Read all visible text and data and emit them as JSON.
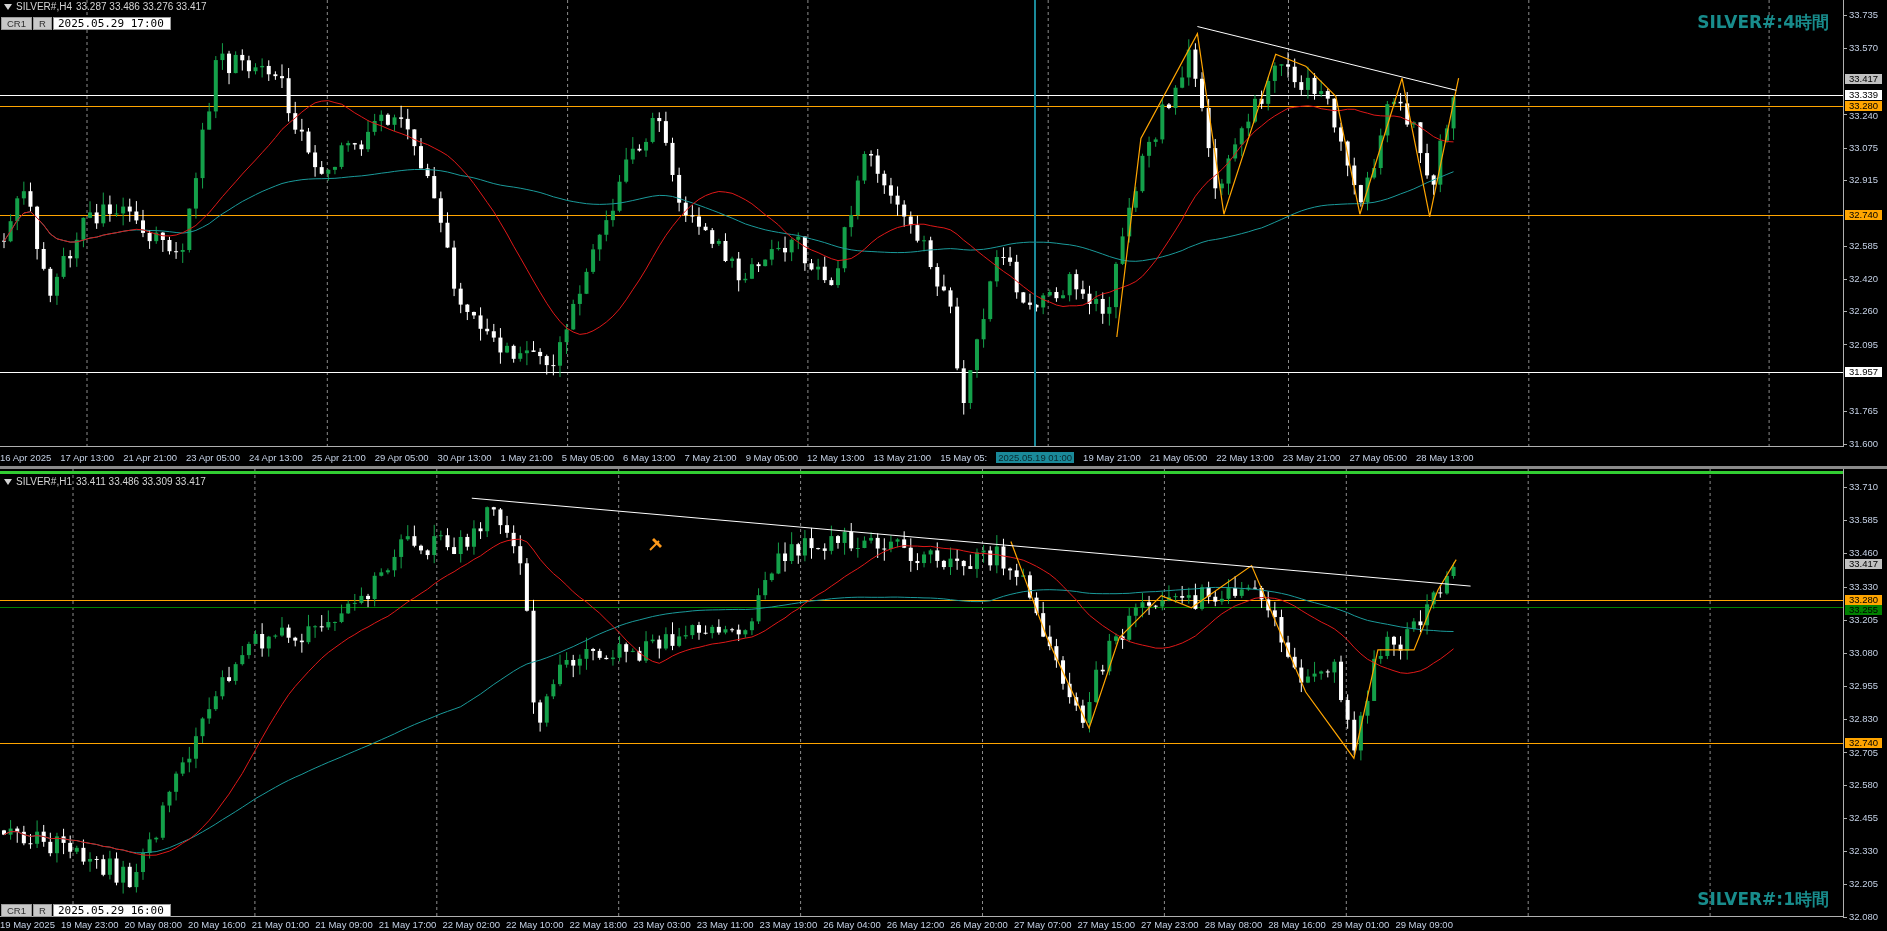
{
  "panels": [
    {
      "symbol": "SILVER#,H4",
      "ohlc": "33.287 33.486 33.276 33.417",
      "active": false,
      "buttons": [
        "CR1",
        "R"
      ],
      "crosshair_time": "2025.05.29 17:00",
      "title": "SILVER#:4時間",
      "price_ticks": [
        "33.735",
        "33.570",
        "33.240",
        "33.075",
        "32.915",
        "32.585",
        "32.420",
        "32.260",
        "32.095",
        "31.765",
        "31.600"
      ],
      "price_labels": [
        {
          "text": "33.417",
          "color": "#c0c0c0"
        },
        {
          "text": "33.339",
          "color": "#ffffff",
          "level_line": true
        },
        {
          "text": "33.280",
          "color": "#ffa500",
          "level_line": true
        },
        {
          "text": "32.740",
          "color": "#ffa500",
          "level_line": true
        },
        {
          "text": "31.957",
          "color": "#ffffff",
          "level_line": true
        }
      ],
      "time_labels": [
        {
          "text": "16 Apr 2025",
          "kind": "tick"
        },
        {
          "text": "17 Apr 13:00",
          "kind": "tick"
        },
        {
          "text": "21 Apr 21:00",
          "kind": "tick"
        },
        {
          "text": "23 Apr 05:00",
          "kind": "tick"
        },
        {
          "text": "24 Apr 13:00",
          "kind": "tick"
        },
        {
          "text": "25 Apr 21:00",
          "kind": "tick"
        },
        {
          "text": "29 Apr 05:00",
          "kind": "tick"
        },
        {
          "text": "30 Apr 13:00",
          "kind": "tick"
        },
        {
          "text": "1 May 21:00",
          "kind": "tick"
        },
        {
          "text": "5 May 05:00",
          "kind": "tick"
        },
        {
          "text": "6 May 13:00",
          "kind": "tick"
        },
        {
          "text": "7 May 21:00",
          "kind": "tick"
        },
        {
          "text": "9 May 05:00",
          "kind": "tick"
        },
        {
          "text": "12 May 13:00",
          "kind": "tick"
        },
        {
          "text": "13 May 21:00",
          "kind": "tick"
        },
        {
          "text": "15 May 05:",
          "kind": "tick"
        },
        {
          "text": "2025.05.19 01:00",
          "kind": "crosshair"
        },
        {
          "text": "19 May 21:00",
          "kind": "tick"
        },
        {
          "text": "21 May 05:00",
          "kind": "tick"
        },
        {
          "text": "22 May 13:00",
          "kind": "tick"
        },
        {
          "text": "23 May 21:00",
          "kind": "tick"
        },
        {
          "text": "27 May 05:00",
          "kind": "tick"
        },
        {
          "text": "28 May 13:00",
          "kind": "tick"
        }
      ]
    },
    {
      "symbol": "SILVER#,H1",
      "ohlc": "33.411 33.486 33.309 33.417",
      "active": true,
      "buttons": [
        "CR1",
        "R"
      ],
      "crosshair_time": "2025.05.29 16:00",
      "title": "SILVER#:1時間",
      "price_ticks": [
        "33.710",
        "33.585",
        "33.460",
        "33.330",
        "33.205",
        "33.080",
        "32.955",
        "32.830",
        "32.705",
        "32.580",
        "32.455",
        "32.330",
        "32.205",
        "32.080"
      ],
      "price_labels": [
        {
          "text": "33.417",
          "color": "#c0c0c0"
        },
        {
          "text": "33.280",
          "color": "#ffa500",
          "level_line": true
        },
        {
          "text": "33.255",
          "color": "#008000",
          "level_line": true
        },
        {
          "text": "32.740",
          "color": "#ffa500",
          "level_line": true
        }
      ],
      "time_labels": [
        {
          "text": "19 May 2025",
          "kind": "tick"
        },
        {
          "text": "19 May 23:00",
          "kind": "tick"
        },
        {
          "text": "20 May 08:00",
          "kind": "tick"
        },
        {
          "text": "20 May 16:00",
          "kind": "tick"
        },
        {
          "text": "21 May 01:00",
          "kind": "tick"
        },
        {
          "text": "21 May 09:00",
          "kind": "tick"
        },
        {
          "text": "21 May 17:00",
          "kind": "tick"
        },
        {
          "text": "22 May 02:00",
          "kind": "tick"
        },
        {
          "text": "22 May 10:00",
          "kind": "tick"
        },
        {
          "text": "22 May 18:00",
          "kind": "tick"
        },
        {
          "text": "23 May 03:00",
          "kind": "tick"
        },
        {
          "text": "23 May 11:00",
          "kind": "tick"
        },
        {
          "text": "23 May 19:00",
          "kind": "tick"
        },
        {
          "text": "26 May 04:00",
          "kind": "tick"
        },
        {
          "text": "26 May 12:00",
          "kind": "tick"
        },
        {
          "text": "26 May 20:00",
          "kind": "tick"
        },
        {
          "text": "27 May 07:00",
          "kind": "tick"
        },
        {
          "text": "27 May 15:00",
          "kind": "tick"
        },
        {
          "text": "27 May 23:00",
          "kind": "tick"
        },
        {
          "text": "28 May 08:00",
          "kind": "tick"
        },
        {
          "text": "28 May 16:00",
          "kind": "tick"
        },
        {
          "text": "29 May 01:00",
          "kind": "tick"
        },
        {
          "text": "29 May 09:00",
          "kind": "tick"
        }
      ]
    }
  ]
}
